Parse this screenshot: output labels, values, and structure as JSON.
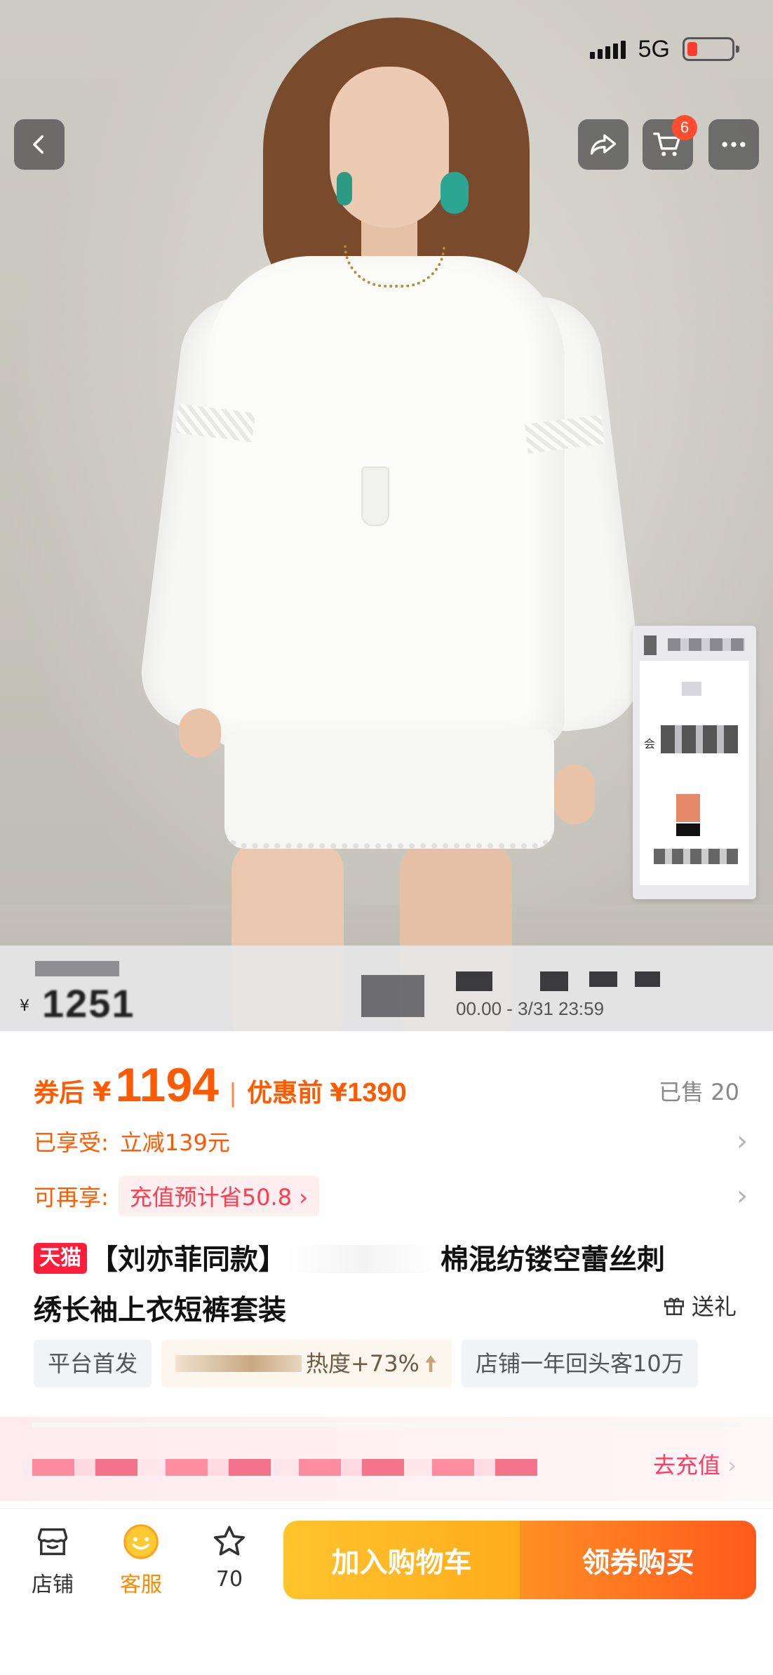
{
  "status_bar": {
    "network": "5G",
    "signal_icon": "signal-bars-icon",
    "battery_icon": "battery-low-icon",
    "battery_color": "#ff3b30"
  },
  "nav": {
    "back_icon": "back-arrow-icon",
    "share_icon": "share-icon",
    "cart_icon": "cart-icon",
    "cart_badge": "6",
    "more_icon": "more-dots-icon"
  },
  "price_strip": {
    "currency": "¥",
    "price": "1251",
    "time_range": "00.00 - 3/31 23:59"
  },
  "floating_card": {
    "label": "会"
  },
  "price": {
    "after_coupon_label": "券后",
    "currency": "¥",
    "after_coupon_value": "1194",
    "separator": "|",
    "before_label": "优惠前",
    "before_currency": "¥",
    "before_value": "1390",
    "sold_label": "已售 20",
    "accent_color": "#ff5a00"
  },
  "discount_row": {
    "label": "已享受:",
    "value": "立减139元"
  },
  "extra_row": {
    "label": "可再享:",
    "pill": "充值预计省50.8",
    "pill_chevron": "›"
  },
  "title": {
    "platform_badge": "天猫",
    "part1": "【刘亦菲同款】",
    "part2": "棉混纺镂空蕾丝刺",
    "line2": "绣长袖上衣短裤套装"
  },
  "gift": {
    "icon": "gift-icon",
    "label": "送礼"
  },
  "tags": [
    {
      "label": "平台首发"
    },
    {
      "label": "热度+73%",
      "icon": "arrow-up-icon"
    },
    {
      "label": "店铺一年回头客10万"
    }
  ],
  "banner": {
    "cta": "去充值"
  },
  "bottom_bar": {
    "shop": {
      "label": "店铺",
      "icon": "store-icon"
    },
    "service": {
      "label": "客服",
      "icon": "service-smiley-icon"
    },
    "favorite": {
      "label": "70",
      "icon": "star-icon"
    },
    "add_to_cart": "加入购物车",
    "buy_now": "领券购买"
  }
}
